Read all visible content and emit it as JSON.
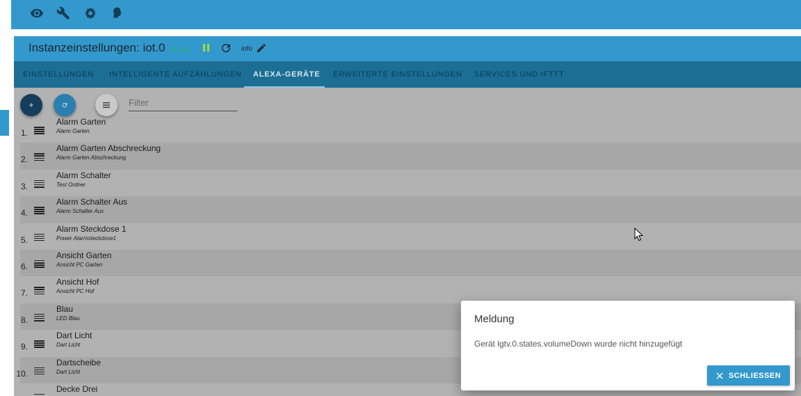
{
  "topbar": {
    "icons": [
      "eye-icon",
      "wrench-icon",
      "settings-icon",
      "user-icon"
    ]
  },
  "instance": {
    "title": "Instanzeinstellungen: iot.0",
    "version": "v2.0.11",
    "info_label": "info"
  },
  "tabs": [
    {
      "label": "EINSTELLUNGEN",
      "active": false
    },
    {
      "label": "INTELLIGENTE AUFZÄHLUNGEN",
      "active": false
    },
    {
      "label": "ALEXA-GERÄTE",
      "active": true
    },
    {
      "label": "ERWEITERTE EINSTELLUNGEN",
      "active": false
    },
    {
      "label": "SERVICES UND IFTTT",
      "active": false
    }
  ],
  "toolbar": {
    "add_label": "+",
    "filter_placeholder": "Filter"
  },
  "devices": [
    {
      "num": "1.",
      "name": "Alarm Garten",
      "sub": "Alarm Garten"
    },
    {
      "num": "2.",
      "name": "Alarm Garten Abschreckung",
      "sub": "Alarm Garten Abschreckung"
    },
    {
      "num": "3.",
      "name": "Alarm Schalter",
      "sub": "Test Ordner"
    },
    {
      "num": "4.",
      "name": "Alarm Schalter Aus",
      "sub": "Alarm Schalter Aus"
    },
    {
      "num": "5.",
      "name": "Alarm Steckdose 1",
      "sub": "Power Alarmsteckdose1"
    },
    {
      "num": "6.",
      "name": "Ansicht Garten",
      "sub": "Ansicht PC Garten"
    },
    {
      "num": "7.",
      "name": "Ansicht Hof",
      "sub": "Ansicht PC Hof"
    },
    {
      "num": "8.",
      "name": "Blau",
      "sub": "LED Blau"
    },
    {
      "num": "9.",
      "name": "Dart Licht",
      "sub": "Dart Licht"
    },
    {
      "num": "10.",
      "name": "Dartscheibe",
      "sub": "Dart Licht"
    },
    {
      "num": "",
      "name": "Decke Drei",
      "sub": ""
    }
  ],
  "dialog": {
    "title": "Meldung",
    "message": "Gerät lgtv.0.states.volumeDown wurde nicht hinzugefügt",
    "close_label": "SCHLIESSEN"
  },
  "colors": {
    "primary": "#3399cc",
    "tab_bar": "#1c6e94",
    "content_bg": "#b2b2b2",
    "row_alt": "#a7a7a7"
  }
}
